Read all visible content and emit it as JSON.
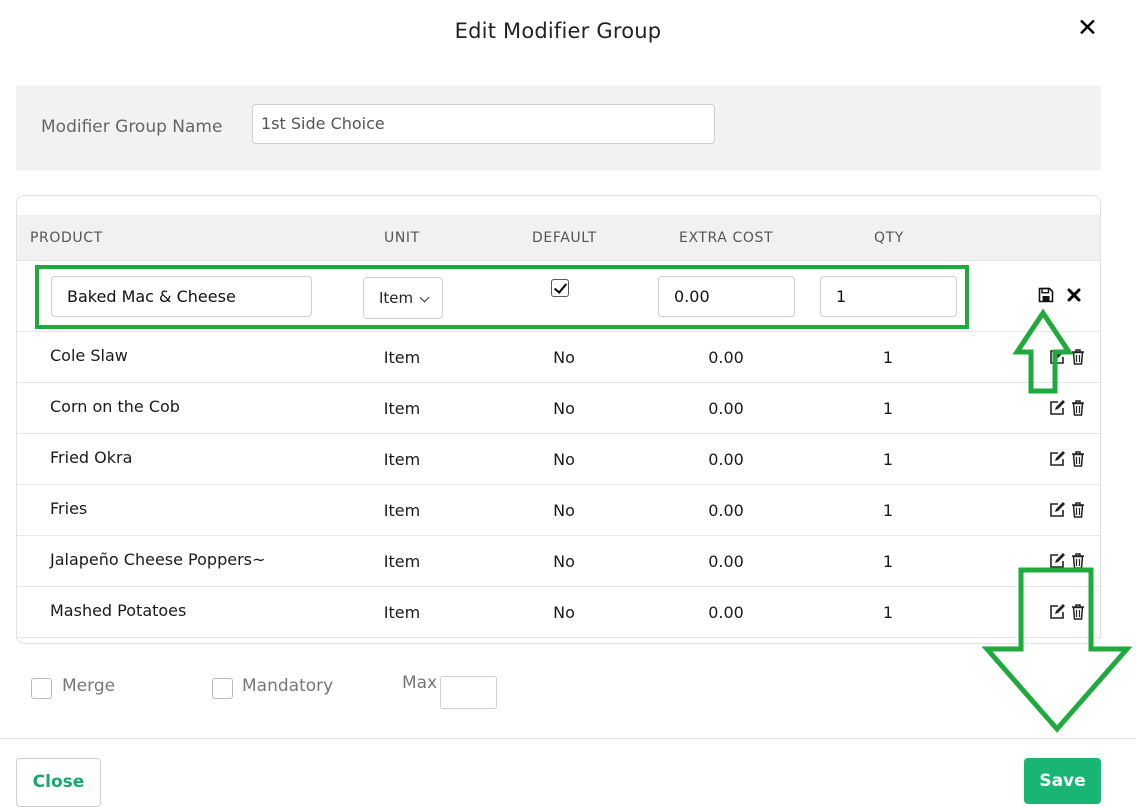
{
  "modal": {
    "title": "Edit Modifier Group",
    "close_icon": "close-icon"
  },
  "group_name": {
    "label": "Modifier Group Name",
    "value": "1st Side Choice"
  },
  "table": {
    "headers": [
      "PRODUCT",
      "UNIT",
      "DEFAULT",
      "EXTRA COST",
      "QTY"
    ],
    "editing_row": {
      "product": "Baked Mac & Cheese",
      "unit": "Item",
      "default_checked": true,
      "extra_cost": "0.00",
      "qty": "1",
      "icons": [
        "save-icon",
        "cancel-icon"
      ]
    },
    "rows": [
      {
        "product": "Cole Slaw",
        "unit": "Item",
        "default": "No",
        "extra_cost": "0.00",
        "qty": "1"
      },
      {
        "product": "Corn on the Cob",
        "unit": "Item",
        "default": "No",
        "extra_cost": "0.00",
        "qty": "1"
      },
      {
        "product": "Fried Okra",
        "unit": "Item",
        "default": "No",
        "extra_cost": "0.00",
        "qty": "1"
      },
      {
        "product": "Fries",
        "unit": "Item",
        "default": "No",
        "extra_cost": "0.00",
        "qty": "1"
      },
      {
        "product": "Jalapeño Cheese Poppers~",
        "unit": "Item",
        "default": "No",
        "extra_cost": "0.00",
        "qty": "1"
      },
      {
        "product": "Mashed Potatoes",
        "unit": "Item",
        "default": "No",
        "extra_cost": "0.00",
        "qty": "1"
      }
    ],
    "row_icons": [
      "edit-icon",
      "trash-icon"
    ]
  },
  "options": {
    "merge_label": "Merge",
    "mandatory_label": "Mandatory",
    "max_label": "Max",
    "max_value": ""
  },
  "footer": {
    "close_label": "Close",
    "save_label": "Save"
  },
  "colors": {
    "annotation_green": "#1faa3e",
    "primary_green": "#19b572",
    "close_text_green": "#17a86b"
  }
}
